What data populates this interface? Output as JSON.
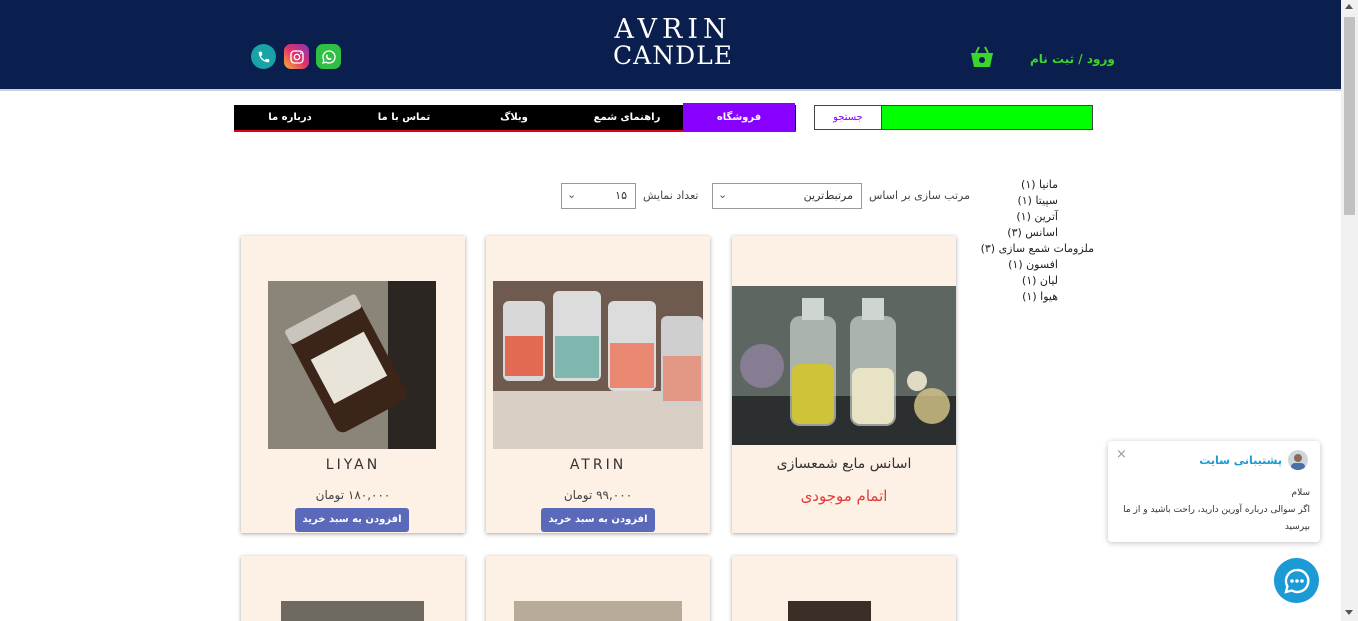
{
  "header": {
    "logo_line1": "AVRIN",
    "logo_line2": "CANDLE",
    "login_label": "ورود / ثبت نام",
    "social": [
      "phone-icon",
      "instagram-icon",
      "whatsapp-icon"
    ],
    "background_color": "#0a1f4e",
    "accent_color": "#3bd52e"
  },
  "nav": {
    "items": [
      {
        "label": "فروشگاه",
        "active": true
      },
      {
        "label": "راهنمای شمع",
        "active": false
      },
      {
        "label": "وبلاگ",
        "active": false
      },
      {
        "label": "تماس با ما",
        "active": false
      },
      {
        "label": "درباره ما",
        "active": false
      }
    ],
    "active_color": "#8800ff",
    "border_color": "#e0001b"
  },
  "search": {
    "button_label": "جستجو",
    "placeholder": "",
    "value": "",
    "bar_color": "#00ff00"
  },
  "filters": {
    "sort_label": "مرتب سازی بر اساس",
    "sort_value": "مرتبط‌ترین",
    "count_label": "تعداد نمایش",
    "count_value": "۱۵"
  },
  "categories": [
    "مانیا (۱)",
    "سپیتا (۱)",
    "آترین (۱)",
    "اسانس (۳)",
    "ملزومات شمع سازی (۳)",
    "افسون (۱)",
    "لیان (۱)",
    "هیوا (۱)"
  ],
  "products": [
    {
      "name": "اسانس مایع شمعسازی",
      "status": "اتمام موجودی"
    },
    {
      "name": "ATRIN",
      "price": "۹۹,۰۰۰ تومان",
      "button": "افزودن به سبد خرید"
    },
    {
      "name": "LIYAN",
      "price": "۱۸۰,۰۰۰ تومان",
      "button": "افزودن به سبد خرید"
    }
  ],
  "chat": {
    "title": "پشتیبانی سایت",
    "greeting": "سلام",
    "message": "اگر سوالی درباره آورین دارید، راحت باشید و از ما بپرسید",
    "close_label": "×",
    "brand_color": "#1b9ad6"
  }
}
